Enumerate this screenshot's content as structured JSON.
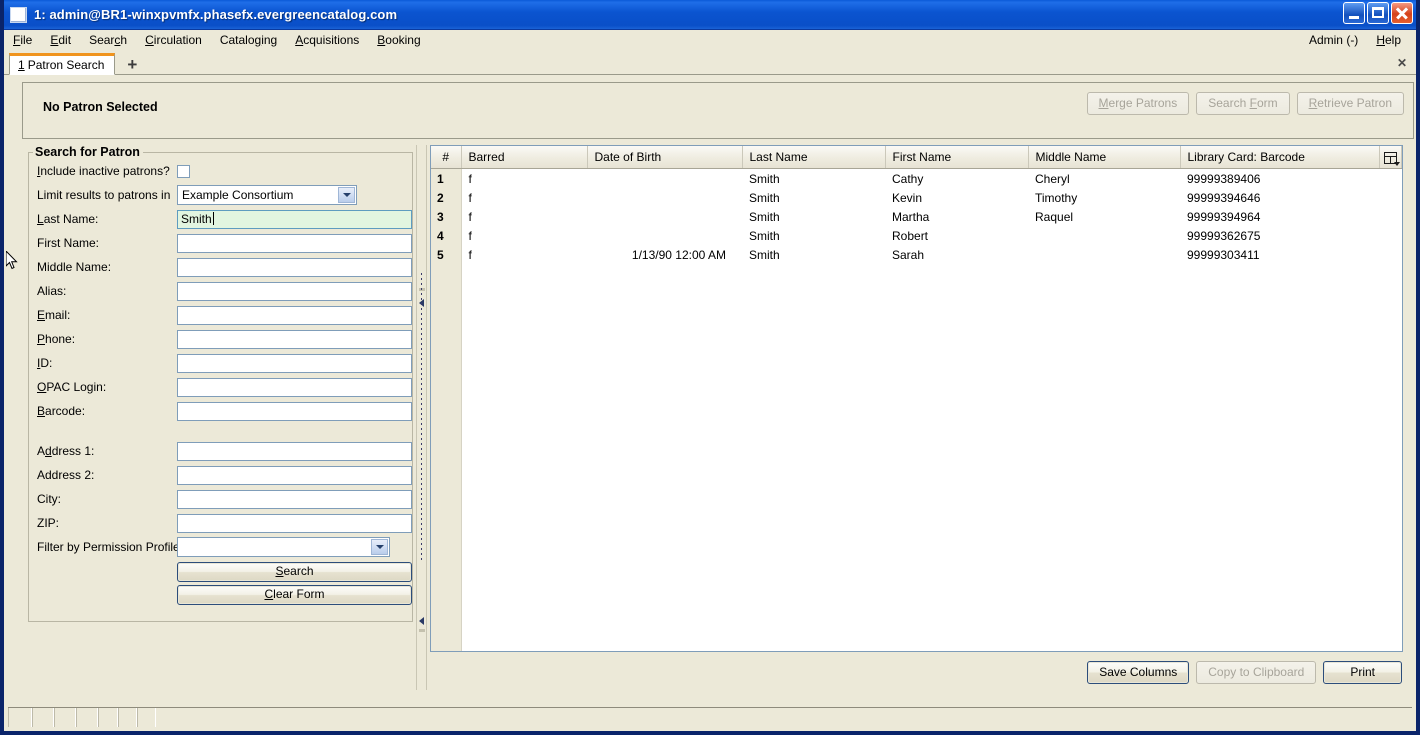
{
  "window": {
    "title": "1: admin@BR1-winxpvmfx.phasefx.evergreencatalog.com",
    "icon": "window-icon",
    "minimize": "–",
    "maximize": "□",
    "close": "✕"
  },
  "menubar": {
    "items": [
      {
        "label": "File",
        "acc": "F",
        "rest": "ile"
      },
      {
        "label": "Edit",
        "acc": "E",
        "rest": "dit"
      },
      {
        "label": "Search",
        "pre": "Sear",
        "acc": "c",
        "rest": "h"
      },
      {
        "label": "Circulation",
        "acc": "C",
        "rest": "irculation"
      },
      {
        "label": "Cataloging",
        "pre": "Catalo",
        "acc": "g",
        "rest": "ing"
      },
      {
        "label": "Acquisitions",
        "acc": "A",
        "rest": "cquisitions"
      },
      {
        "label": "Booking",
        "acc": "B",
        "rest": "ooking"
      }
    ],
    "admin": "Admin (-)",
    "help": "Help",
    "help_acc": "H",
    "help_rest": "elp"
  },
  "tabbar": {
    "tab_number": "1",
    "tab_label": "Patron Search",
    "add_tab": "+",
    "close_all": "✕"
  },
  "patron_banner": {
    "status": "No Patron Selected",
    "buttons": [
      {
        "label": "Merge Patrons",
        "acc": "M",
        "rest": "erge Patrons",
        "pre": "",
        "disabled": true
      },
      {
        "label": "Search Form",
        "pre": "Search ",
        "acc": "F",
        "rest": "orm",
        "disabled": true
      },
      {
        "label": "Retrieve Patron",
        "acc": "R",
        "rest": "etrieve Patron",
        "pre": "",
        "disabled": true
      }
    ]
  },
  "search_form": {
    "legend": "Search for Patron",
    "include_inactive_label": "Include inactive patrons?",
    "include_inactive_acc": "I",
    "include_inactive_rest": "nclude inactive patrons?",
    "include_inactive_checked": false,
    "limit_label": "Limit results to patrons in",
    "limit_value": "Example Consortium",
    "fields": [
      {
        "label": "Last Name:",
        "pre": "",
        "acc": "L",
        "rest": "ast Name:",
        "value": "Smith",
        "active": true,
        "name": "last-name"
      },
      {
        "label": "First Name:",
        "pre": "First Name:",
        "acc": "",
        "rest": "",
        "value": "",
        "active": false,
        "name": "first-name"
      },
      {
        "label": "Middle Name:",
        "pre": "Middle Name:",
        "acc": "",
        "rest": "",
        "value": "",
        "active": false,
        "name": "middle-name"
      },
      {
        "label": "Alias:",
        "pre": "Alias:",
        "acc": "",
        "rest": "",
        "value": "",
        "active": false,
        "name": "alias"
      },
      {
        "label": "Email:",
        "pre": "",
        "acc": "E",
        "rest": "mail:",
        "value": "",
        "active": false,
        "name": "email"
      },
      {
        "label": "Phone:",
        "pre": "",
        "acc": "P",
        "rest": "hone:",
        "value": "",
        "active": false,
        "name": "phone"
      },
      {
        "label": "ID:",
        "pre": "",
        "acc": "I",
        "rest": "D:",
        "value": "",
        "active": false,
        "name": "id"
      },
      {
        "label": "OPAC Login:",
        "pre": "",
        "acc": "O",
        "rest": "PAC Login:",
        "value": "",
        "active": false,
        "name": "opac-login"
      },
      {
        "label": "Barcode:",
        "pre": "",
        "acc": "B",
        "rest": "arcode:",
        "value": "",
        "active": false,
        "name": "barcode"
      }
    ],
    "address_fields": [
      {
        "label": "Address 1:",
        "pre": "A",
        "acc": "d",
        "rest": "dress 1:",
        "value": "",
        "name": "address-1"
      },
      {
        "label": "Address 2:",
        "pre": "Address 2:",
        "acc": "",
        "rest": "",
        "value": "",
        "name": "address-2"
      },
      {
        "label": "City:",
        "pre": "City:",
        "acc": "",
        "rest": "",
        "value": "",
        "name": "city"
      },
      {
        "label": "ZIP:",
        "pre": "ZIP:",
        "acc": "",
        "rest": "",
        "value": "",
        "name": "zip"
      }
    ],
    "permission_label": "Filter by Permission Profile:",
    "permission_value": "",
    "search_button": "Search",
    "search_acc": "S",
    "search_rest": "earch",
    "clear_button": "Clear Form",
    "clear_acc": "C",
    "clear_rest": "lear Form"
  },
  "results": {
    "columns": [
      "#",
      "Barred",
      "Date of Birth",
      "Last Name",
      "First Name",
      "Middle Name",
      "Library Card: Barcode"
    ],
    "column_picker_icon": "column-picker-icon",
    "rows": [
      {
        "num": "1",
        "barred": "f",
        "dob": "",
        "last": "Smith",
        "first": "Cathy",
        "middle": "Cheryl",
        "barcode": "99999389406"
      },
      {
        "num": "2",
        "barred": "f",
        "dob": "",
        "last": "Smith",
        "first": "Kevin",
        "middle": "Timothy",
        "barcode": "99999394646"
      },
      {
        "num": "3",
        "barred": "f",
        "dob": "",
        "last": "Smith",
        "first": "Martha",
        "middle": "Raquel",
        "barcode": "99999394964"
      },
      {
        "num": "4",
        "barred": "f",
        "dob": "",
        "last": "Smith",
        "first": "Robert",
        "middle": "",
        "barcode": "99999362675"
      },
      {
        "num": "5",
        "barred": "f",
        "dob": "1/13/90 12:00 AM",
        "last": "Smith",
        "first": "Sarah",
        "middle": "",
        "barcode": "99999303411"
      }
    ],
    "buttons": [
      {
        "label": "Save Columns",
        "disabled": false
      },
      {
        "label": "Copy to Clipboard",
        "disabled": true
      },
      {
        "label": "Print",
        "disabled": false
      }
    ]
  },
  "colors": {
    "titlebar_blue": "#0b54d0",
    "window_border": "#0a246a",
    "chrome_beige": "#ece9d8",
    "active_field_green": "#e2f5e0",
    "tab_accent_orange": "#f0941e",
    "field_border_blue": "#7f9db9"
  }
}
